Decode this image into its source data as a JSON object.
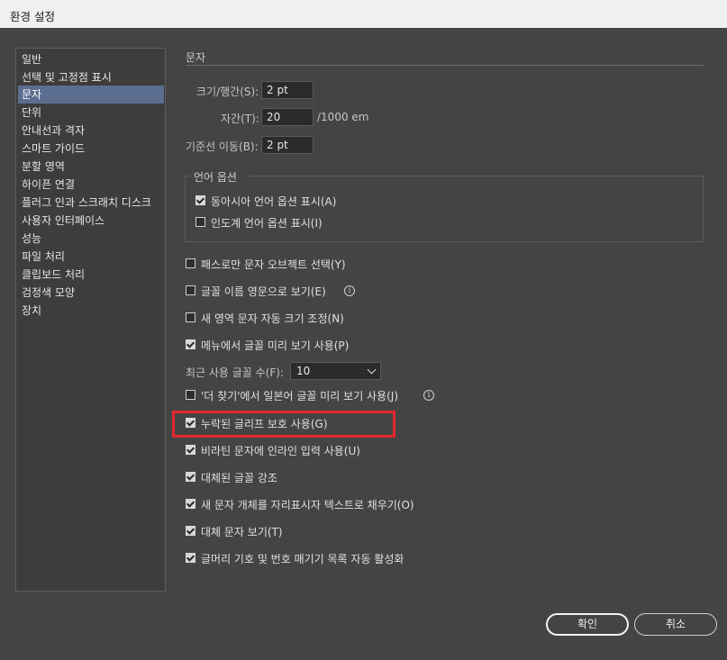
{
  "window": {
    "title": "환경 설정"
  },
  "sidebar": {
    "items": [
      {
        "label": "일반"
      },
      {
        "label": "선택 및 고정점 표시"
      },
      {
        "label": "문자",
        "active": true
      },
      {
        "label": "단위"
      },
      {
        "label": "안내선과 격자"
      },
      {
        "label": "스마트 가이드"
      },
      {
        "label": "분할 영역"
      },
      {
        "label": "하이픈 연결"
      },
      {
        "label": "플러그 인과 스크래치 디스크"
      },
      {
        "label": "사용자 인터페이스"
      },
      {
        "label": "성능"
      },
      {
        "label": "파일 처리"
      },
      {
        "label": "클립보드 처리"
      },
      {
        "label": "검정색 모양"
      },
      {
        "label": "장치"
      }
    ]
  },
  "section": {
    "title": "문자"
  },
  "fields": {
    "size_leading": {
      "label": "크기/행간(S):",
      "value": "2 pt"
    },
    "tracking": {
      "label": "자간(T):",
      "value": "20",
      "unit": "/1000 em"
    },
    "baseline_shift": {
      "label": "기준선 이동(B):",
      "value": "2 pt"
    }
  },
  "language_options": {
    "title": "언어 옵션",
    "items": [
      {
        "label": "동아시아 언어 옵션 표시(A)",
        "checked": true
      },
      {
        "label": "인도계 언어 옵션 표시(I)",
        "checked": false
      }
    ]
  },
  "options": [
    {
      "label": "패스로만 문자 오브젝트 선택(Y)",
      "checked": false
    },
    {
      "label": "글꼴 이름 영문으로 보기(E)",
      "checked": false,
      "info_icon": "info-icon"
    },
    {
      "label": "새 영역 문자 자동 크기 조정(N)",
      "checked": false
    },
    {
      "label": "메뉴에서 글꼴 미리 보기 사용(P)",
      "checked": true
    }
  ],
  "recent_fonts": {
    "label": "최근 사용 글꼴 수(F):",
    "value": "10"
  },
  "options2": [
    {
      "label": "'더 찾기'에서 일본어 글꼴 미리 보기 사용(J)",
      "checked": false,
      "info_icon": "info-icon"
    },
    {
      "label": "누락된 글리프 보호 사용(G)",
      "checked": true,
      "highlighted": true
    },
    {
      "label": "비라틴 문자에 인라인 입력 사용(U)",
      "checked": true
    },
    {
      "label": "대체된 글꼴 강조",
      "checked": true
    },
    {
      "label": "새 문자 개체를 자리표시자 텍스트로 채우기(O)",
      "checked": true
    },
    {
      "label": "대체 문자 보기(T)",
      "checked": true
    },
    {
      "label": "글머리 기호 및 번호 매기기 목록 자동 활성화",
      "checked": true
    }
  ],
  "buttons": {
    "ok": "확인",
    "cancel": "취소"
  },
  "colors": {
    "highlight": "#e0262d",
    "active_item": "#5b6e8f"
  }
}
